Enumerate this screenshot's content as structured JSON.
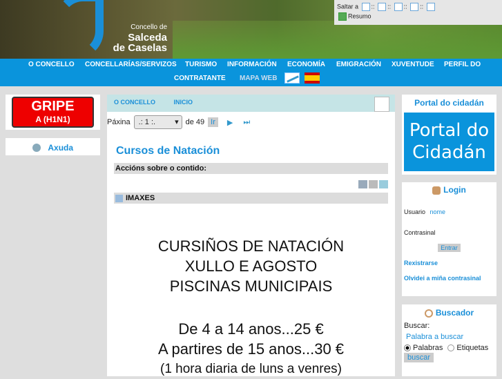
{
  "header": {
    "logo_line1": "Concello de",
    "logo_line2": "Salceda",
    "logo_line3": "de Caselas",
    "skip_label": "Saltar a",
    "skip_sep": "::",
    "summary_label": "Resumo"
  },
  "nav": {
    "items": [
      "O CONCELLO",
      "CONCELLARÍAS/SERVIZOS",
      "TURISMO",
      "INFORMACIÓN",
      "ECONOMÍA",
      "EMIGRACIÓN",
      "XUVENTUDE",
      "PERFIL DO",
      "CONTRATANTE",
      "MAPA WEB"
    ]
  },
  "left": {
    "banner_line1": "GRIPE",
    "banner_line2": "A (H1N1)",
    "help": "Axuda"
  },
  "center": {
    "breadcrumbs": [
      "O CONCELLO",
      "INICIO"
    ],
    "page_label": "Páxina",
    "page_value": ".: 1 :.",
    "page_of": "de 49",
    "go": "Ir",
    "title": "Cursos de Natación",
    "actions": "Accións sobre o contido:",
    "images": "IMAXES",
    "poster": [
      "CURSIÑOS DE NATACIÓN",
      "XULLO E AGOSTO",
      "PISCINAS MUNICIPAIS",
      "De 4 a 14 anos...25 €",
      "A partires de 15 anos...30 €",
      "(1 hora diaria de luns a venres)"
    ]
  },
  "right": {
    "portal_title": "Portal do cidadán",
    "portal_banner1": "Portal do",
    "portal_banner2": "Cidadán",
    "login_title": "Login",
    "user_label": "Usuario",
    "user_value": "nome",
    "pass_label": "Contrasinal",
    "enter": "Entrar",
    "register": "Rexistrarse",
    "forgot": "Olvidei a miña contrasinal",
    "search_title": "Buscador",
    "search_label": "Buscar:",
    "search_placeholder": "Palabra a buscar",
    "opt_words": "Palabras",
    "opt_tags": "Etiquetas",
    "search_button": "buscar"
  }
}
